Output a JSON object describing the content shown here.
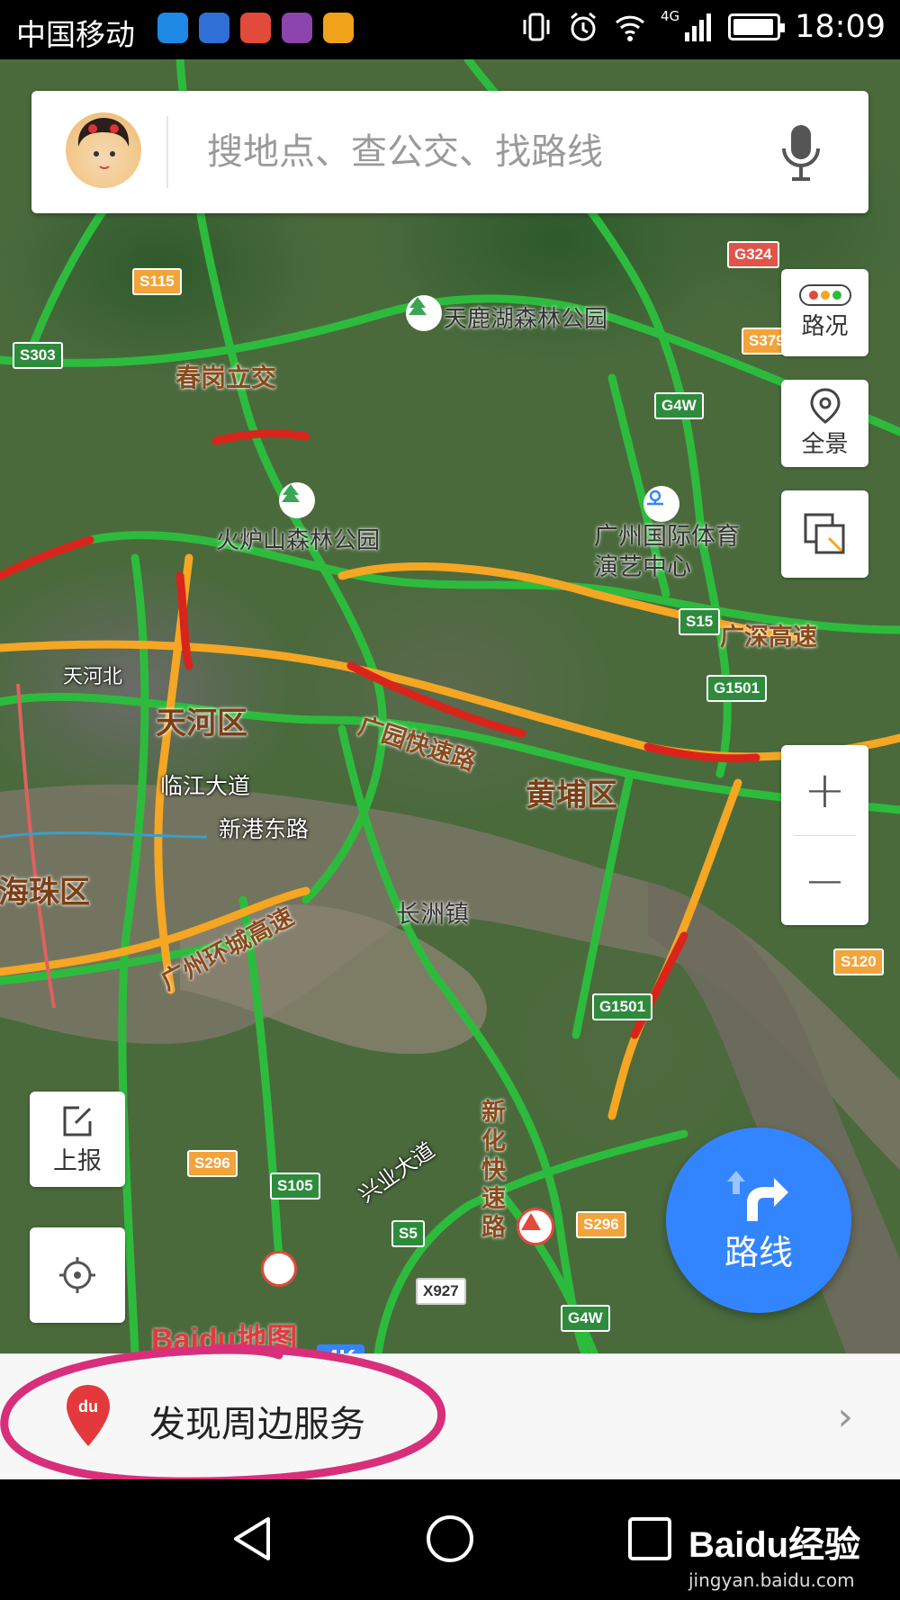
{
  "status_bar": {
    "carrier": "中国移动",
    "network": "4G",
    "time": "18:09"
  },
  "search": {
    "placeholder": "搜地点、查公交、找路线"
  },
  "controls": {
    "traffic_label": "路况",
    "panorama_label": "全景",
    "report_label": "上报",
    "route_label": "路线"
  },
  "map": {
    "pois": [
      "天鹿湖森林公园",
      "火炉山森林公园",
      "广州国际体育演艺中心",
      "长洲镇"
    ],
    "districts": [
      "天河区",
      "黄埔区",
      "海珠区"
    ],
    "interchanges": [
      "春岗立交"
    ],
    "roads": [
      "广园快速路",
      "广深高速",
      "广州环城高速",
      "新化快速路",
      "临江大道",
      "新港东路",
      "兴业大道",
      "天河北"
    ],
    "road_shields": [
      "S303",
      "S115",
      "G324",
      "S379",
      "G4W",
      "S15",
      "G1501",
      "S120",
      "S296",
      "S105",
      "S5",
      "X927",
      "G4W",
      "S296",
      "G1501"
    ],
    "logo_brand": "Baidu地图",
    "badge": "4K"
  },
  "discover": {
    "label": "发现周边服务"
  },
  "watermark": {
    "main": "Baidu经验",
    "sub": "jingyan.baidu.com"
  },
  "colors": {
    "accent": "#3385ff",
    "traffic_red": "#d9241c",
    "traffic_orange": "#f5a623",
    "traffic_green": "#2dbb3d"
  }
}
